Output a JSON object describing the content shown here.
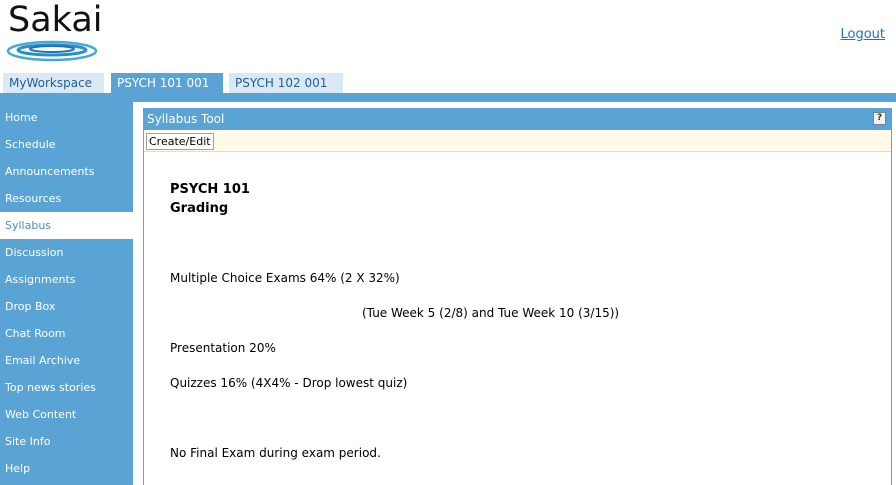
{
  "header": {
    "logo_text": "Sakai",
    "logout_label": "Logout"
  },
  "site_tabs": [
    {
      "label": "MyWorkspace",
      "selected": false
    },
    {
      "label": "PSYCH 101 001",
      "selected": true
    },
    {
      "label": "PSYCH 102 001",
      "selected": false
    }
  ],
  "nav": {
    "items": [
      {
        "label": "Home"
      },
      {
        "label": "Schedule"
      },
      {
        "label": "Announcements"
      },
      {
        "label": "Resources"
      },
      {
        "label": "Syllabus",
        "selected": true
      },
      {
        "label": "Discussion"
      },
      {
        "label": "Assignments"
      },
      {
        "label": "Drop Box"
      },
      {
        "label": "Chat Room"
      },
      {
        "label": "Email Archive"
      },
      {
        "label": "Top news stories"
      },
      {
        "label": "Web Content"
      },
      {
        "label": "Site Info"
      },
      {
        "label": "Help"
      }
    ]
  },
  "tool": {
    "title": "Syllabus Tool",
    "help_label": "?",
    "create_edit_label": "Create/Edit"
  },
  "syllabus": {
    "course": "PSYCH 101",
    "heading": "Grading",
    "exams": "Multiple Choice Exams 64% (2 X 32%)",
    "exam_dates": "(Tue Week 5 (2/8) and Tue Week 10 (3/15))",
    "presentation": "Presentation 20%",
    "quizzes": "Quizzes 16% (4X4% - Drop lowest quiz)",
    "final_note": "No Final Exam during exam period."
  },
  "colors": {
    "accent": "#5aa4d5",
    "link": "#1f75b5",
    "toolbar_bg": "#fffbe8"
  }
}
